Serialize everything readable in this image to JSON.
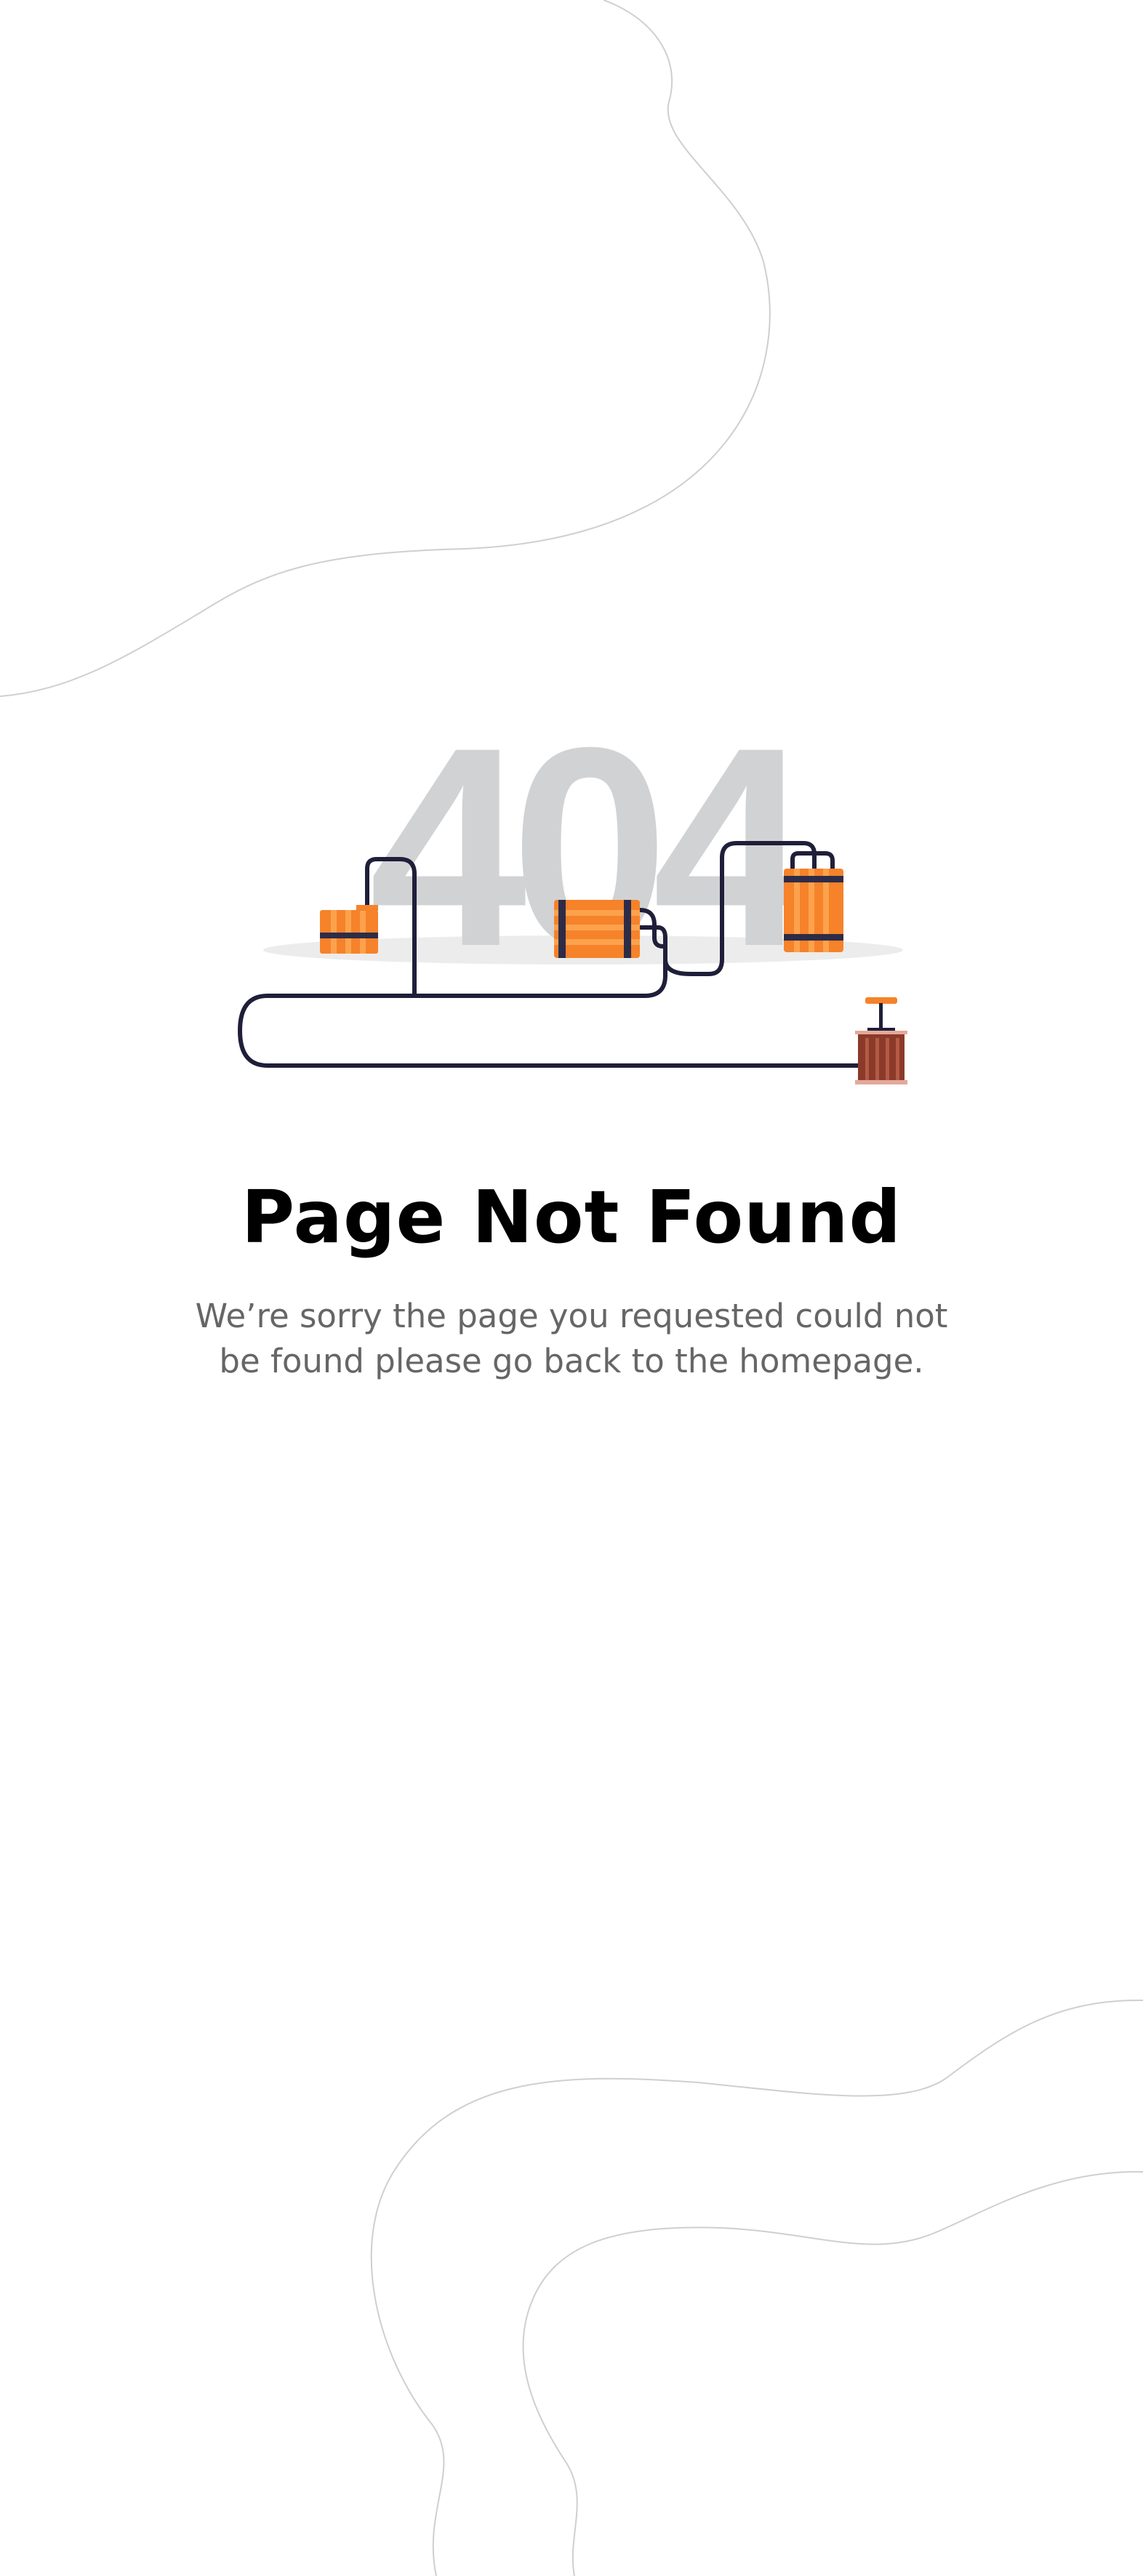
{
  "illustration": {
    "big_text": "404",
    "icons": [
      "dynamite-icon",
      "detonator-icon"
    ]
  },
  "error": {
    "title": "Page Not Found",
    "message": "We’re sorry the page you requested could not be found please go back to the homepage."
  },
  "colors": {
    "background": "#ffffff",
    "title": "#000000",
    "message": "#666666",
    "big_text": "#d1d2d4",
    "dynamite_orange": "#f6822a",
    "dynamite_stripe": "#2d2c48",
    "wire": "#1f1f3a",
    "detonator": "#8b3a2a",
    "curve_line": "#cfcfcf"
  }
}
